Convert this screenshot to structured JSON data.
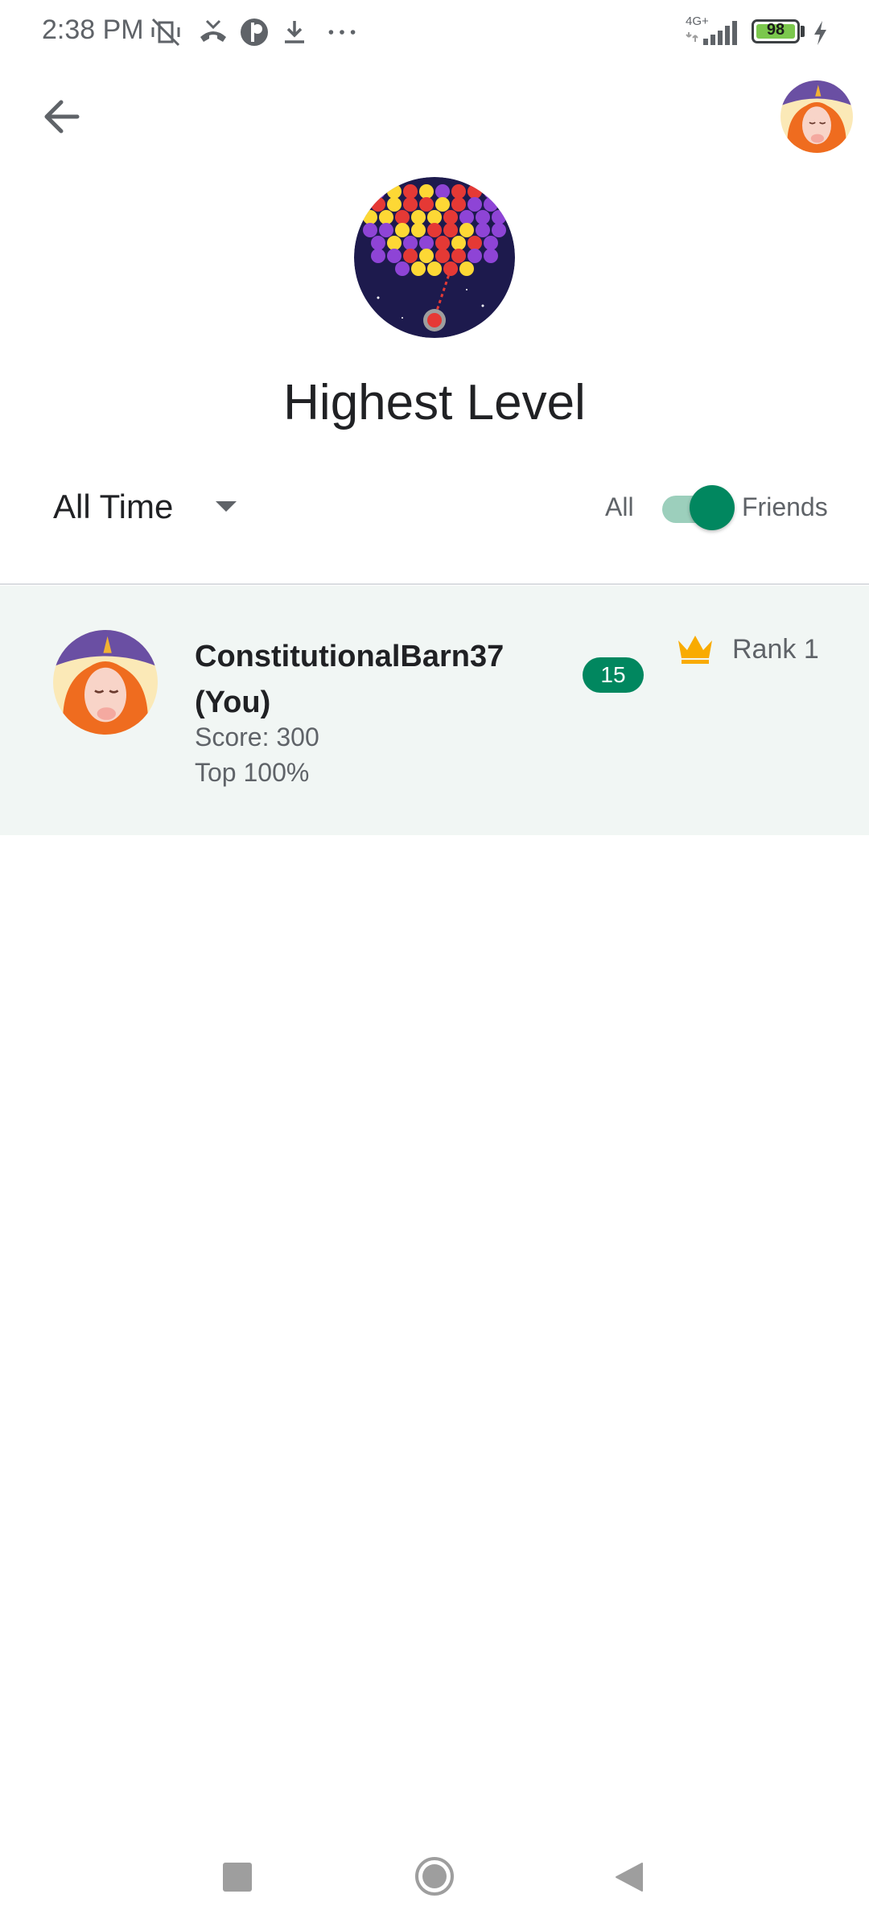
{
  "status_bar": {
    "time": "2:38 PM",
    "network": "4G+",
    "battery": "98",
    "icons": [
      "mute-vibrate-icon",
      "missed-call-icon",
      "app-notification-icon",
      "download-icon",
      "more-dots-icon",
      "signal-icon",
      "charging-icon"
    ]
  },
  "header": {
    "back_icon": "arrow-left-icon",
    "avatar": "unicorn-avatar"
  },
  "leaderboard": {
    "game_icon": "bubble-shooter-icon",
    "title": "Highest Level",
    "time_filter": "All Time",
    "toggle_left": "All",
    "toggle_right": "Friends",
    "toggle_on": true
  },
  "entries": [
    {
      "name": "ConstitutionalBarn37 (You)",
      "score": "Score: 300",
      "percentile": "Top 100%",
      "level": "15",
      "rank": "Rank 1"
    }
  ],
  "colors": {
    "accent": "#01875f",
    "accent_light": "#9ccfbc",
    "row_bg": "#f1f6f4",
    "crown": "#f9ab00"
  }
}
